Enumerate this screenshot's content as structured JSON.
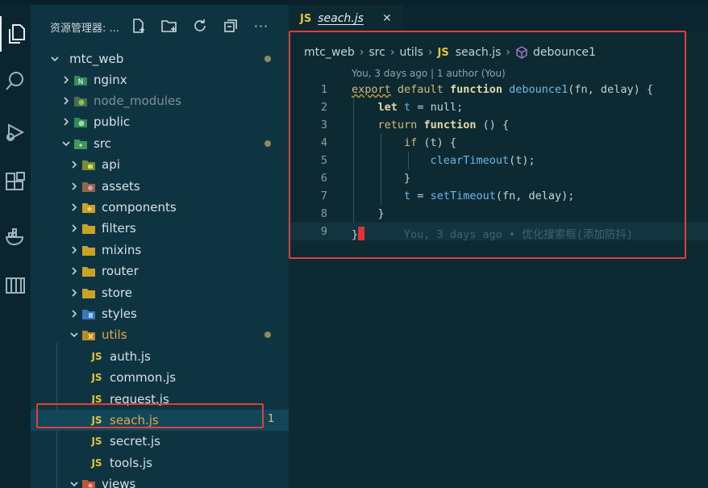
{
  "sidebar": {
    "title": "资源管理器: ...",
    "tree": [
      {
        "label": "mtc_web",
        "type": "root",
        "expanded": true,
        "dot": true
      },
      {
        "label": "nginx",
        "type": "folder",
        "icon": "nginx-folder-icon"
      },
      {
        "label": "node_modules",
        "type": "folder",
        "icon": "node-folder-icon",
        "dim": true
      },
      {
        "label": "public",
        "type": "folder",
        "icon": "public-folder-icon"
      },
      {
        "label": "src",
        "type": "folder",
        "icon": "src-folder-icon",
        "expanded": true,
        "dot": true
      },
      {
        "label": "api",
        "type": "folder",
        "icon": "api-folder-icon"
      },
      {
        "label": "assets",
        "type": "folder",
        "icon": "assets-folder-icon"
      },
      {
        "label": "components",
        "type": "folder",
        "icon": "components-folder-icon"
      },
      {
        "label": "filters",
        "type": "folder",
        "icon": "folder-icon"
      },
      {
        "label": "mixins",
        "type": "folder",
        "icon": "folder-icon"
      },
      {
        "label": "router",
        "type": "folder",
        "icon": "folder-icon"
      },
      {
        "label": "store",
        "type": "folder",
        "icon": "folder-icon"
      },
      {
        "label": "styles",
        "type": "folder",
        "icon": "styles-folder-icon"
      },
      {
        "label": "utils",
        "type": "folder",
        "icon": "utils-folder-icon",
        "expanded": true,
        "dot": true,
        "orange": true
      },
      {
        "label": "auth.js",
        "type": "file"
      },
      {
        "label": "common.js",
        "type": "file"
      },
      {
        "label": "request.js",
        "type": "file"
      },
      {
        "label": "seach.js",
        "type": "file",
        "selected": true,
        "badge": "1"
      },
      {
        "label": "secret.js",
        "type": "file"
      },
      {
        "label": "tools.js",
        "type": "file"
      },
      {
        "label": "views",
        "type": "folder",
        "icon": "views-folder-icon",
        "expanded": true
      }
    ],
    "js_icon_text": "JS"
  },
  "editor": {
    "tab": {
      "label": "seach.js",
      "close": "✕",
      "icon_text": "JS"
    },
    "breadcrumb": [
      "mtc_web",
      "src",
      "utils",
      "seach.js",
      "debounce1"
    ],
    "codelens": "You, 3 days ago | 1 author (You)",
    "line_numbers": [
      "1",
      "2",
      "3",
      "4",
      "5",
      "6",
      "7",
      "8",
      "9"
    ],
    "blame": "You, 3 days ago • 优化搜索框(添加防抖)",
    "code": {
      "l1": {
        "export": "export",
        "default": "default",
        "function": "function",
        "name": "debounce1",
        "params": "(fn, delay) {"
      },
      "l2": {
        "let": "let",
        "var": "t",
        "rest": " = null;"
      },
      "l3": {
        "return": "return",
        "function": "function",
        "rest": " () {"
      },
      "l4": {
        "if": "if",
        "rest": " (t) {"
      },
      "l5": {
        "call": "clearTimeout",
        "rest": "(t);"
      },
      "l6": {
        "text": "}"
      },
      "l7": {
        "var": "t",
        "eq": " = ",
        "call": "setTimeout",
        "rest": "(fn, delay);"
      },
      "l8": {
        "text": "}"
      },
      "l9": {
        "text": "}"
      }
    }
  },
  "colors": {
    "highlight_box": "#e0403a",
    "js_icon": "#e3c33d",
    "modified_folder": "#e5a64a"
  }
}
